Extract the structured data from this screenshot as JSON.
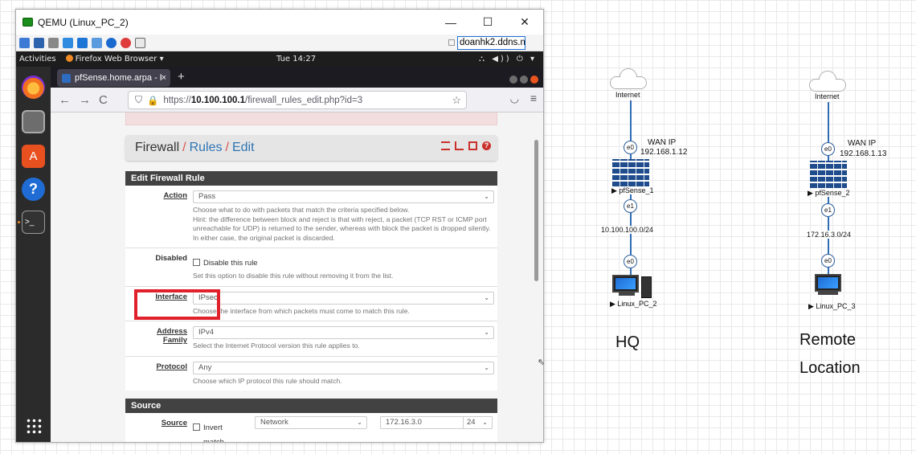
{
  "qemu": {
    "title": "QEMU (Linux_PC_2)",
    "minimize": "—",
    "maximize": "☐",
    "close": "✕",
    "address_field": "doanhk2.ddns.n"
  },
  "gnome": {
    "activities": "Activities",
    "app_menu": "Firefox Web Browser ▾",
    "clock": "Tue 14:27",
    "tray": "⛬ ◀)) ⏻ ▾"
  },
  "firefox": {
    "tab_title": "pfSense.home.arpa - Fire",
    "tab_close": "×",
    "new_tab": "+",
    "back": "←",
    "forward": "→",
    "reload": "C",
    "url_prefix": "https://",
    "url_host": "10.100.100.1",
    "url_path": "/firewall_rules_edit.php?id=3",
    "star": "☆",
    "pocket": "◡",
    "menu": "≡"
  },
  "pfsense": {
    "breadcrumb": {
      "part1": "Firewall",
      "sep": "/",
      "part2": "Rules",
      "part3": "Edit"
    },
    "panel1_title": "Edit Firewall Rule",
    "action": {
      "label": "Action",
      "value": "Pass",
      "help1": "Choose what to do with packets that match the criteria specified below.",
      "help2": "Hint: the difference between block and reject is that with reject, a packet (TCP RST or ICMP port unreachable for UDP) is returned to the sender, whereas with block the packet is dropped silently. In either case, the original packet is discarded."
    },
    "disabled": {
      "label": "Disabled",
      "checkbox_label": "Disable this rule",
      "help": "Set this option to disable this rule without removing it from the list."
    },
    "interface": {
      "label": "Interface",
      "value": "IPsec",
      "help": "Choose the interface from which packets must come to match this rule."
    },
    "address_family": {
      "label_line1": "Address",
      "label_line2": "Family",
      "value": "IPv4",
      "help": "Select the Internet Protocol version this rule applies to."
    },
    "protocol": {
      "label": "Protocol",
      "value": "Any",
      "help": "Choose which IP protocol this rule should match."
    },
    "panel2_title": "Source",
    "source": {
      "label": "Source",
      "invert_line1": "Invert",
      "invert_line2": "match",
      "type": "Network",
      "address": "172.16.3.0",
      "slash": "/",
      "mask": "24"
    }
  },
  "diagram": {
    "hq": {
      "cloud_label": "Internet",
      "wan_port": "e0",
      "wan_ip_line1": "WAN IP",
      "wan_ip_line2": "192.168.1.12",
      "router": "▶ pfSense_1",
      "lan_port": "e1",
      "subnet": "10.100.100.0/24",
      "pc_port": "e0",
      "pc": "▶ Linux_PC_2",
      "site_label": "HQ"
    },
    "remote": {
      "cloud_label": "Internet",
      "wan_port": "e0",
      "wan_ip_line1": "WAN IP",
      "wan_ip_line2": "192.168.1.13",
      "router": "▶ pfSense_2",
      "lan_port": "e1",
      "subnet": "172.16.3.0/24",
      "pc_port": "e0",
      "pc": "▶ Linux_PC_3",
      "site_label_line1": "Remote",
      "site_label_line2": "Location"
    }
  },
  "colors": {
    "highlight_box": "#e0202a",
    "pfsense_accent": "#c9302c",
    "link_blue": "#2f75b5",
    "diagram_line": "#2f6db5"
  }
}
